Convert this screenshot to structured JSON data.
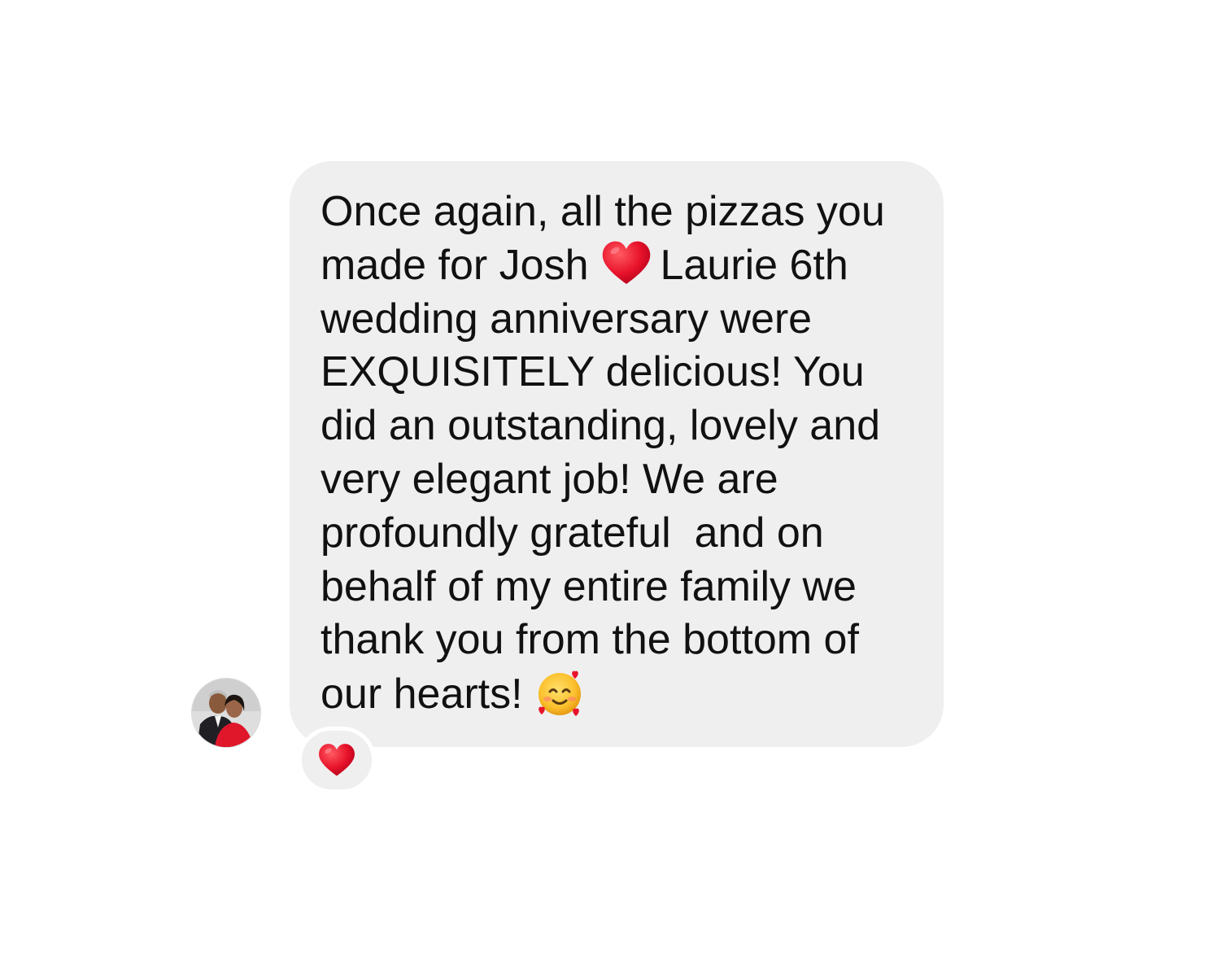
{
  "message": {
    "lines": [
      {
        "before": "Once again, all the pizzas you"
      },
      {
        "before": "made for Josh",
        "emoji": "red-heart",
        "after": "Laurie 6th"
      },
      {
        "before": "wedding anniversary were"
      },
      {
        "before": "EXQUISITELY delicious! You"
      },
      {
        "before": "did an outstanding, lovely and"
      },
      {
        "before": "very elegant job! We are"
      },
      {
        "before": "profoundly grateful  and on"
      },
      {
        "before": "behalf of my entire family we"
      },
      {
        "before": "thank you from the bottom of"
      },
      {
        "before": "our hearts!",
        "emoji": "smiling-face-with-hearts"
      }
    ]
  },
  "reaction": {
    "emoji": "red-heart"
  },
  "icons": {
    "heart_color": "#e8132b",
    "bubble_color": "#efefef"
  }
}
